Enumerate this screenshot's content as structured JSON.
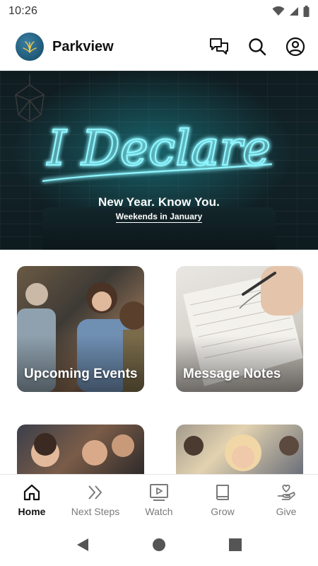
{
  "status_bar": {
    "time": "10:26",
    "icons": [
      "wifi-icon",
      "signal-icon",
      "battery-icon"
    ]
  },
  "header": {
    "title": "Parkview",
    "actions": [
      "chat-icon",
      "search-icon",
      "account-icon"
    ]
  },
  "hero": {
    "headline": "I Declare",
    "subtitle": "New Year. Know You.",
    "caption": "Weekends in January"
  },
  "cards": [
    {
      "label": "Upcoming Events"
    },
    {
      "label": "Message Notes"
    },
    {
      "label": ""
    },
    {
      "label": ""
    }
  ],
  "bottom_nav": {
    "items": [
      {
        "label": "Home",
        "icon": "home-icon",
        "active": true
      },
      {
        "label": "Next Steps",
        "icon": "double-chevron-icon",
        "active": false
      },
      {
        "label": "Watch",
        "icon": "video-icon",
        "active": false
      },
      {
        "label": "Grow",
        "icon": "book-icon",
        "active": false
      },
      {
        "label": "Give",
        "icon": "heart-hand-icon",
        "active": false
      }
    ]
  },
  "colors": {
    "accent": "#2d6e8f",
    "neon": "#6ff3ff",
    "inactive": "#7a7a7a"
  }
}
